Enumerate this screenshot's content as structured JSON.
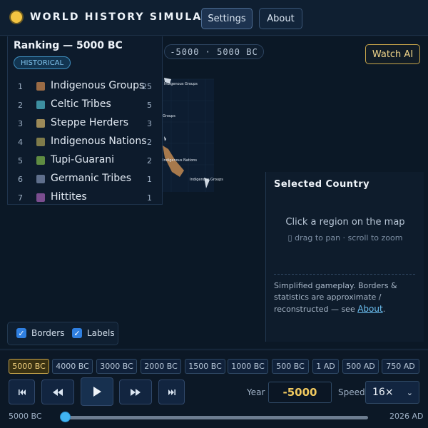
{
  "app": {
    "title": "WORLD HISTORY SIMULATOR",
    "nav": {
      "settings": "Settings",
      "about": "About"
    }
  },
  "map": {
    "era_range": "-5000 · 5000 BC",
    "watch_ai": "Watch AI",
    "labels": [
      {
        "text": "Indigenous Groups"
      },
      {
        "text": "Groups"
      },
      {
        "text": "Indigenous Nations"
      },
      {
        "text": "Indigenous Groups"
      },
      {
        "text": "Nations"
      }
    ]
  },
  "ranking": {
    "title": "Ranking — 5000 BC",
    "badge": "HISTORICAL",
    "items": [
      {
        "rank": "1",
        "name": "Indigenous Groups",
        "count": "25",
        "color": "#9a6b45"
      },
      {
        "rank": "2",
        "name": "Celtic Tribes",
        "count": "5",
        "color": "#3d8fa0"
      },
      {
        "rank": "3",
        "name": "Steppe Herders",
        "count": "3",
        "color": "#9c8a58"
      },
      {
        "rank": "4",
        "name": "Indigenous Nations",
        "count": "2",
        "color": "#7f7b4a"
      },
      {
        "rank": "5",
        "name": "Tupi-Guarani",
        "count": "2",
        "color": "#5f8c42"
      },
      {
        "rank": "6",
        "name": "Germanic Tribes",
        "count": "1",
        "color": "#5f6f8c"
      },
      {
        "rank": "7",
        "name": "Hittites",
        "count": "1",
        "color": "#7a4d8f"
      }
    ]
  },
  "selected": {
    "title": "Selected Country",
    "hint": "Click a region on the map",
    "sub": "▯ drag to pan · scroll to zoom",
    "note_prefix": "Simplified gameplay. Borders & statistics are approximate / reconstructed — see ",
    "note_link": "About",
    "note_suffix": "."
  },
  "toggles": {
    "borders": {
      "label": "Borders",
      "checked": true
    },
    "labels": {
      "label": "Labels",
      "checked": true
    }
  },
  "timeline": {
    "eras": [
      "5000 BC",
      "4000 BC",
      "3000 BC",
      "2000 BC",
      "1500 BC",
      "1000 BC",
      "500 BC",
      "1 AD",
      "500 AD",
      "750 AD"
    ],
    "active_era": "5000 BC",
    "year_label": "Year",
    "year_value": "-5000",
    "speed_label": "Speed",
    "speed_value": "16×",
    "range_start": "5000 BC",
    "range_end": "2026 AD",
    "progress": 0
  },
  "colors": {
    "accent": "#f4c542",
    "link": "#6cc0f2",
    "active_era": "#c9a64a"
  }
}
